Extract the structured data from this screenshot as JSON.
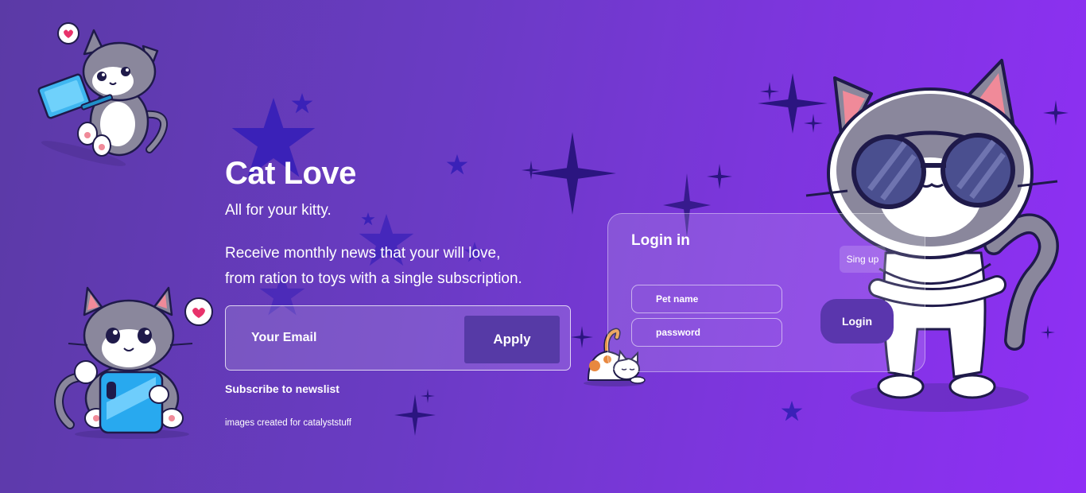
{
  "hero": {
    "title": "Cat Love",
    "tagline": "All for your kitty.",
    "description_line1": "Receive monthly news that your will love,",
    "description_line2": "from ration to toys with a single subscription."
  },
  "subscribe_form": {
    "email_placeholder": "Your Email",
    "apply_label": "Apply",
    "subscribe_label": "Subscribe to newslist"
  },
  "credit": "images created for catalyststuff",
  "login": {
    "title": "Login in",
    "signup_label": "Sing up",
    "pet_name_placeholder": "Pet name",
    "password_placeholder": "password",
    "login_label": "Login"
  },
  "icons": [
    "laptop-cat-illustration",
    "phone-cat-illustration",
    "sunglasses-cat-illustration",
    "stretching-cat-illustration",
    "star-icon",
    "sparkle-icon",
    "heart-bubble-icon"
  ],
  "colors": {
    "background_start": "#5b3aa6",
    "background_end": "#8f2ff5",
    "button": "#563aa6",
    "star": "#3a1fa0",
    "sparkle": "#2d1a7a",
    "cat_gray": "#7d7b8f"
  }
}
